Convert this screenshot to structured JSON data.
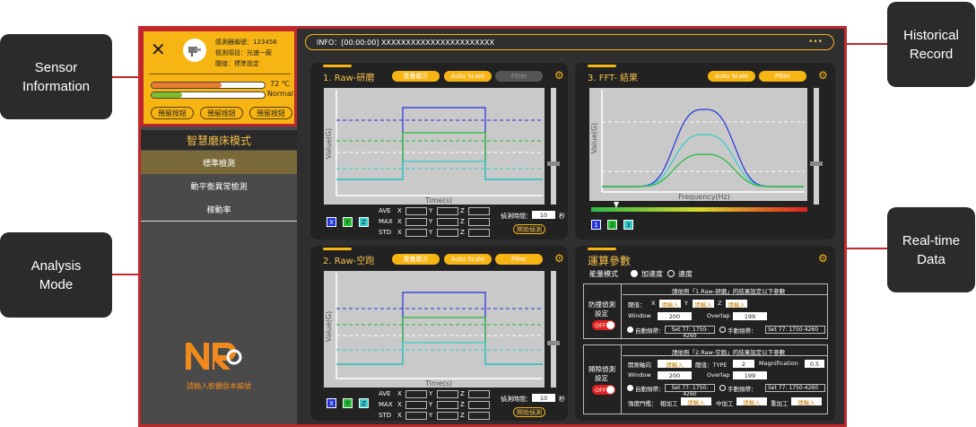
{
  "callouts": {
    "sensor_information": "Sensor\nInformation",
    "analysis_mode": "Analysis\nMode",
    "historical_record": "Historical\nRecord",
    "realtime_data": "Real-time\nData"
  },
  "sensor": {
    "id_line": "感測器編號：123456",
    "item_line": "檢測項目：光速一廠",
    "threshold_line": "閾值：標準設定",
    "temperature": "72 ℃",
    "temperature_level": 0.62,
    "status": "Normal",
    "status_level": 0.27,
    "buttons": [
      "預留按鈕",
      "預留按鈕",
      "預留按鈕"
    ]
  },
  "mode": {
    "title": "智慧磨床模式",
    "items": [
      "標準檢測",
      "動平衡異常檢測",
      "稼動率"
    ],
    "active_index": 0,
    "brand_text": "請輸入軟體版本編號"
  },
  "info": {
    "text": "INFO：[00:00:00] XXXXXXXXXXXXXXXXXXXXXXX",
    "more": "•••"
  },
  "raw1": {
    "title": "1. Raw-研磨",
    "btn_overlay": "重疊顯示",
    "btn_autoscale": "Auto Scale",
    "btn_filter": "Filter",
    "ylabel": "Value(G)",
    "xlabel": "Time(s)",
    "axes": [
      "X",
      "Y",
      "Z"
    ],
    "stats": [
      "AVE",
      "MAX",
      "STD"
    ],
    "detect_time_label": "偵測時間：",
    "detect_time": "10",
    "detect_unit": "秒",
    "start_label": "開始偵測"
  },
  "raw2": {
    "title": "2. Raw-空跑",
    "btn_overlay": "重疊顯示",
    "btn_autoscale": "Auto Scale",
    "btn_filter": "Filter",
    "ylabel": "Value(G)",
    "xlabel": "Time(s)",
    "axes": [
      "X",
      "Y",
      "Z"
    ],
    "stats": [
      "AVE",
      "MAX",
      "STD"
    ],
    "detect_time_label": "偵測時間：",
    "detect_time": "10",
    "detect_unit": "秒",
    "start_label": "開始偵測"
  },
  "fft": {
    "title": "3. FFT- 結果",
    "btn_autoscale": "Auto Scale",
    "btn_filter": "Filter",
    "ylabel": "Value(G)",
    "xlabel": "Frequency(Hz)",
    "channels": [
      "1",
      "2",
      "3"
    ]
  },
  "params": {
    "title": "運算參數",
    "energy_mode_label": "能量模式",
    "energy_options": [
      "加速度",
      "速度"
    ],
    "section1": {
      "header": "請依照「1.Raw-研磨」的結果設定以下參數",
      "side_label_1": "防撞偵測",
      "side_label_2": "設定",
      "toggle": "OFF",
      "threshold_label": "閾值：",
      "axes": [
        "X",
        "Y",
        "Z"
      ],
      "input_placeholder": "請輸入",
      "window_label": "Window",
      "window_value": "200",
      "overlap_label": "Overlap",
      "overlap_value": "199",
      "auto_freq_label": "自動頻帶：",
      "auto_freq_value": "Set 77: 1750-4260",
      "manual_freq_label": "手動頻帶：",
      "manual_freq_value": "Set 77: 1750-4260"
    },
    "section2": {
      "header": "請依照「2.Raw-空跑」的結果設定以下參數",
      "side_label_1": "開隙偵測",
      "side_label_2": "設定",
      "toggle": "OFF",
      "axis_label": "開隙軸向",
      "axis_value": "請輸入",
      "threshold_label": "閾值：TYPE",
      "type_value": "2",
      "magnification_label": "Magnification",
      "magnification_value": "0.5",
      "window_label": "Window",
      "window_value": "200",
      "overlap_label": "Overlap",
      "overlap_value": "199",
      "auto_freq_label": "自動頻帶：",
      "auto_freq_value": "Set 77: 1750-4260",
      "manual_freq_label": "手動頻帶：",
      "manual_freq_value": "Set 77: 1750-4260",
      "strength_label": "強度門檻：",
      "rough_label": "粗加工",
      "medium_label": "中加工",
      "fine_label": "重加工",
      "input_placeholder": "請輸入"
    }
  },
  "colors": {
    "accent": "#f7b514",
    "frame": "#c0272d",
    "x_series": "#2233dd",
    "y_series": "#22bb33",
    "z_series": "#33cccc"
  }
}
